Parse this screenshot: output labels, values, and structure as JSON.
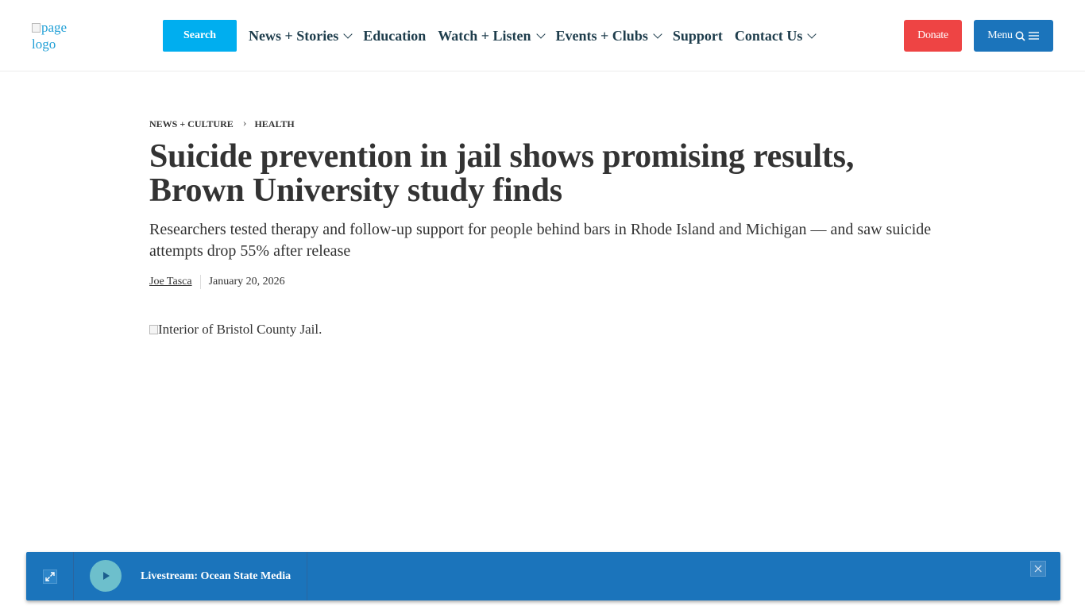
{
  "header": {
    "logo_alt": "page logo",
    "search_label": "Search",
    "nav": [
      {
        "label": "News + Stories",
        "dropdown": true
      },
      {
        "label": "Education",
        "dropdown": false
      },
      {
        "label": "Watch + Listen",
        "dropdown": true
      },
      {
        "label": "Events + Clubs",
        "dropdown": true
      },
      {
        "label": "Support",
        "dropdown": false
      },
      {
        "label": "Contact Us",
        "dropdown": true
      }
    ],
    "donate_label": "Donate",
    "menu_label": "Menu",
    "icons": {
      "menu_search": "search-icon",
      "menu_lines": "hamburger-icon",
      "nav_dropdown": "chevron-down-icon"
    }
  },
  "article": {
    "breadcrumb": [
      "NEWS + CULTURE",
      "HEALTH"
    ],
    "breadcrumb_separator": "›",
    "title": "Suicide prevention in jail shows promising results, Brown University study finds",
    "subtitle": "Researchers tested therapy and follow-up support for people behind bars in Rhode Island and Michigan — and saw suicide attempts drop 55% after release",
    "author": "Joe Tasca",
    "date": "January 20, 2026",
    "hero_alt": "Interior of Bristol County Jail."
  },
  "player": {
    "label": "Livestream: Ocean State Media",
    "icons": {
      "expand": "expand-icon",
      "play": "play-icon",
      "close": "close-icon"
    }
  },
  "colors": {
    "search": "#00aeef",
    "donate": "#ee4444",
    "menu": "#1b74bb",
    "nav_text": "#1e3d4c",
    "player_bg": "#1b74bb",
    "play_circle": "#6dbfcc"
  }
}
